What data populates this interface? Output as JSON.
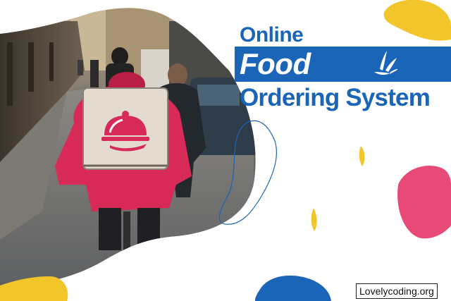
{
  "heading": {
    "line1": "Online",
    "line2": "Food",
    "line3": "Ordering System"
  },
  "site": "Lovelycoding.org",
  "icons": {
    "splash": "splash-icon",
    "delivery": "cloche-icon"
  },
  "colors": {
    "brand_blue": "#1a65b8",
    "yellow": "#f2c62a",
    "pink": "#e84a78",
    "jacket_red": "#d82a58"
  }
}
